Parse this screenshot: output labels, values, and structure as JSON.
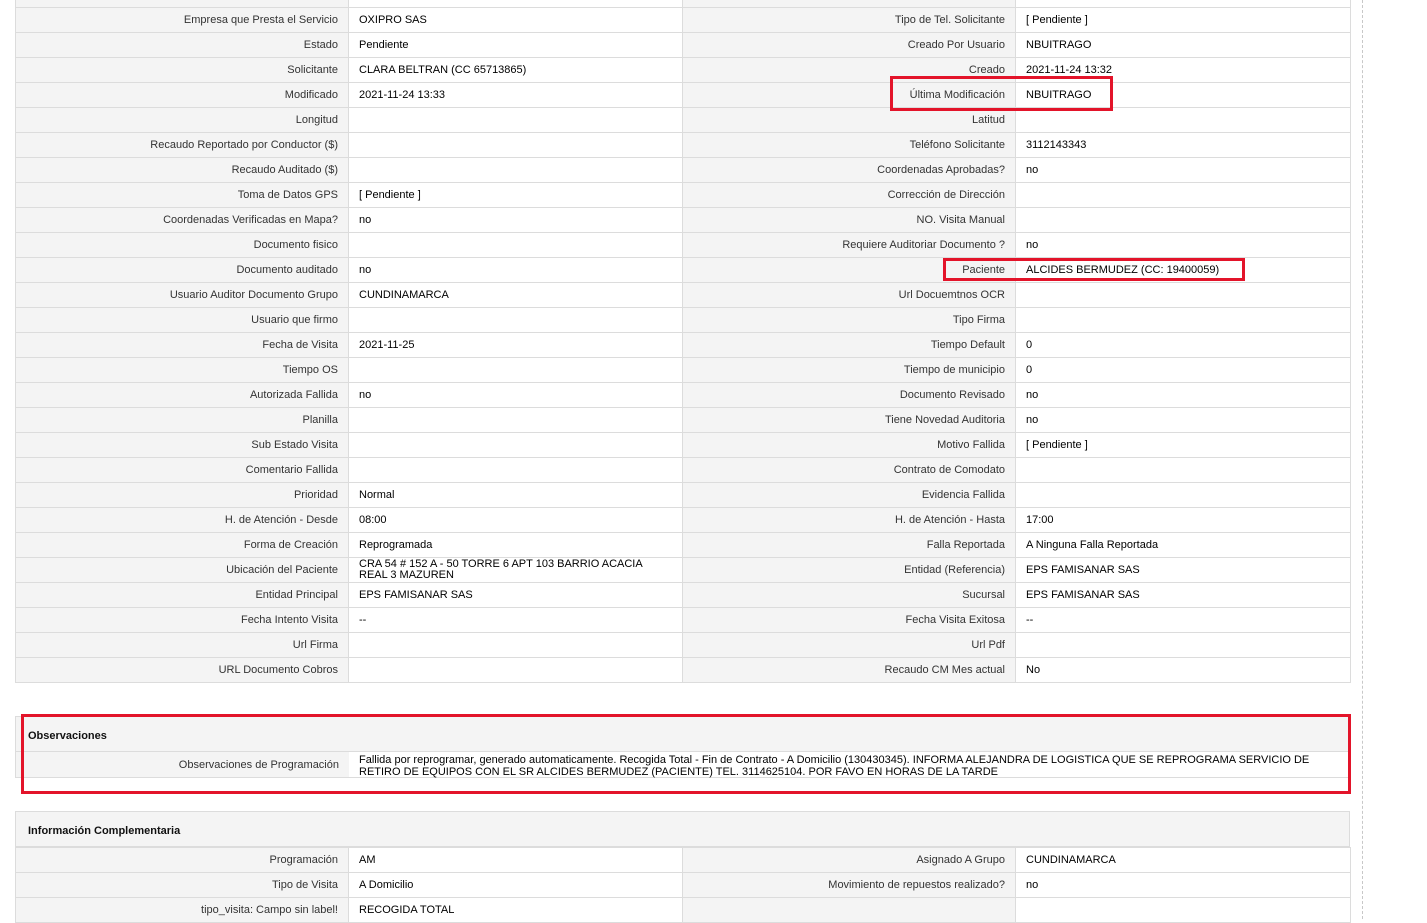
{
  "rows": [
    {
      "l1": "Empresa que Presta el Servicio",
      "v1": "OXIPRO SAS",
      "l2": "Tipo de Tel. Solicitante",
      "v2": "[ Pendiente ]"
    },
    {
      "l1": "Estado",
      "v1": "Pendiente",
      "l2": "Creado Por Usuario",
      "v2": "NBUITRAGO"
    },
    {
      "l1": "Solicitante",
      "v1": "CLARA BELTRAN (CC 65713865)",
      "l2": "Creado",
      "v2": "2021-11-24 13:32"
    },
    {
      "l1": "Modificado",
      "v1": "2021-11-24 13:33",
      "l2": "Última Modificación",
      "v2": "NBUITRAGO"
    },
    {
      "l1": "Longitud",
      "v1": "",
      "l2": "Latitud",
      "v2": ""
    },
    {
      "l1": "Recaudo Reportado por Conductor ($)",
      "v1": "",
      "l2": "Teléfono Solicitante",
      "v2": "3112143343"
    },
    {
      "l1": "Recaudo Auditado ($)",
      "v1": "",
      "l2": "Coordenadas Aprobadas?",
      "v2": "no"
    },
    {
      "l1": "Toma de Datos GPS",
      "v1": "[ Pendiente ]",
      "l2": "Corrección de Dirección",
      "v2": ""
    },
    {
      "l1": "Coordenadas Verificadas en Mapa?",
      "v1": "no",
      "l2": "NO. Visita Manual",
      "v2": ""
    },
    {
      "l1": "Documento fisico",
      "v1": "",
      "l2": "Requiere Auditoriar Documento ?",
      "v2": "no"
    },
    {
      "l1": "Documento auditado",
      "v1": "no",
      "l2": "Paciente",
      "v2": "ALCIDES BERMUDEZ (CC: 19400059)"
    },
    {
      "l1": "Usuario Auditor Documento Grupo",
      "v1": "CUNDINAMARCA",
      "l2": "Url Docuemtnos OCR",
      "v2": ""
    },
    {
      "l1": "Usuario que firmo",
      "v1": "",
      "l2": "Tipo Firma",
      "v2": ""
    },
    {
      "l1": "Fecha de Visita",
      "v1": "2021-11-25",
      "l2": "Tiempo Default",
      "v2": "0"
    },
    {
      "l1": "Tiempo OS",
      "v1": "",
      "l2": "Tiempo de municipio",
      "v2": "0"
    },
    {
      "l1": "Autorizada Fallida",
      "v1": "no",
      "l2": "Documento Revisado",
      "v2": "no"
    },
    {
      "l1": "Planilla",
      "v1": "",
      "l2": "Tiene Novedad Auditoria",
      "v2": "no"
    },
    {
      "l1": "Sub Estado Visita",
      "v1": "",
      "l2": "Motivo Fallida",
      "v2": "[ Pendiente ]"
    },
    {
      "l1": "Comentario Fallida",
      "v1": "",
      "l2": "Contrato de Comodato",
      "v2": ""
    },
    {
      "l1": "Prioridad",
      "v1": "Normal",
      "l2": "Evidencia Fallida",
      "v2": ""
    },
    {
      "l1": "H. de Atención - Desde",
      "v1": "08:00",
      "l2": "H. de Atención - Hasta",
      "v2": "17:00"
    },
    {
      "l1": "Forma de Creación",
      "v1": "Reprogramada",
      "l2": "Falla Reportada",
      "v2": "A Ninguna Falla Reportada"
    },
    {
      "l1": "Ubicación del Paciente",
      "v1": "CRA 54 # 152 A - 50 TORRE 6 APT 103 BARRIO ACACIA REAL 3 MAZUREN",
      "l2": "Entidad (Referencia)",
      "v2": "EPS FAMISANAR SAS"
    },
    {
      "l1": "Entidad Principal",
      "v1": "EPS FAMISANAR SAS",
      "l2": "Sucursal",
      "v2": "EPS FAMISANAR SAS"
    },
    {
      "l1": "Fecha Intento Visita",
      "v1": "--",
      "l2": "Fecha Visita Exitosa",
      "v2": "--"
    },
    {
      "l1": "Url Firma",
      "v1": "",
      "l2": "Url Pdf",
      "v2": ""
    },
    {
      "l1": "URL Documento Cobros",
      "v1": "",
      "l2": "Recaudo CM Mes actual",
      "v2": "No"
    }
  ],
  "observaciones": {
    "title": "Observaciones",
    "label": "Observaciones de Programación",
    "value": "Fallida por reprogramar, generado automaticamente. Recogida Total - Fin de Contrato - A Domicilio (130430345). INFORMA ALEJANDRA DE LOGISTICA QUE SE REPROGRAMA SERVICIO DE RETIRO DE EQUIPOS CON EL SR ALCIDES BERMUDEZ (PACIENTE) TEL. 3114625104. POR FAVO EN HORAS DE LA TARDE"
  },
  "complementaria": {
    "title": "Información Complementaria",
    "rows": [
      {
        "l1": "Programación",
        "v1": "AM",
        "l2": "Asignado A Grupo",
        "v2": "CUNDINAMARCA"
      },
      {
        "l1": "Tipo de Visita",
        "v1": "A Domicilio",
        "l2": "Movimiento de repuestos realizado?",
        "v2": "no"
      },
      {
        "l1": "tipo_visita: Campo sin label!",
        "v1": "RECOGIDA TOTAL",
        "l2": "",
        "v2": ""
      }
    ]
  },
  "colors": {
    "highlight": "#e3142a",
    "label_bg": "#f4f4f4",
    "border": "#dcdcdc"
  }
}
